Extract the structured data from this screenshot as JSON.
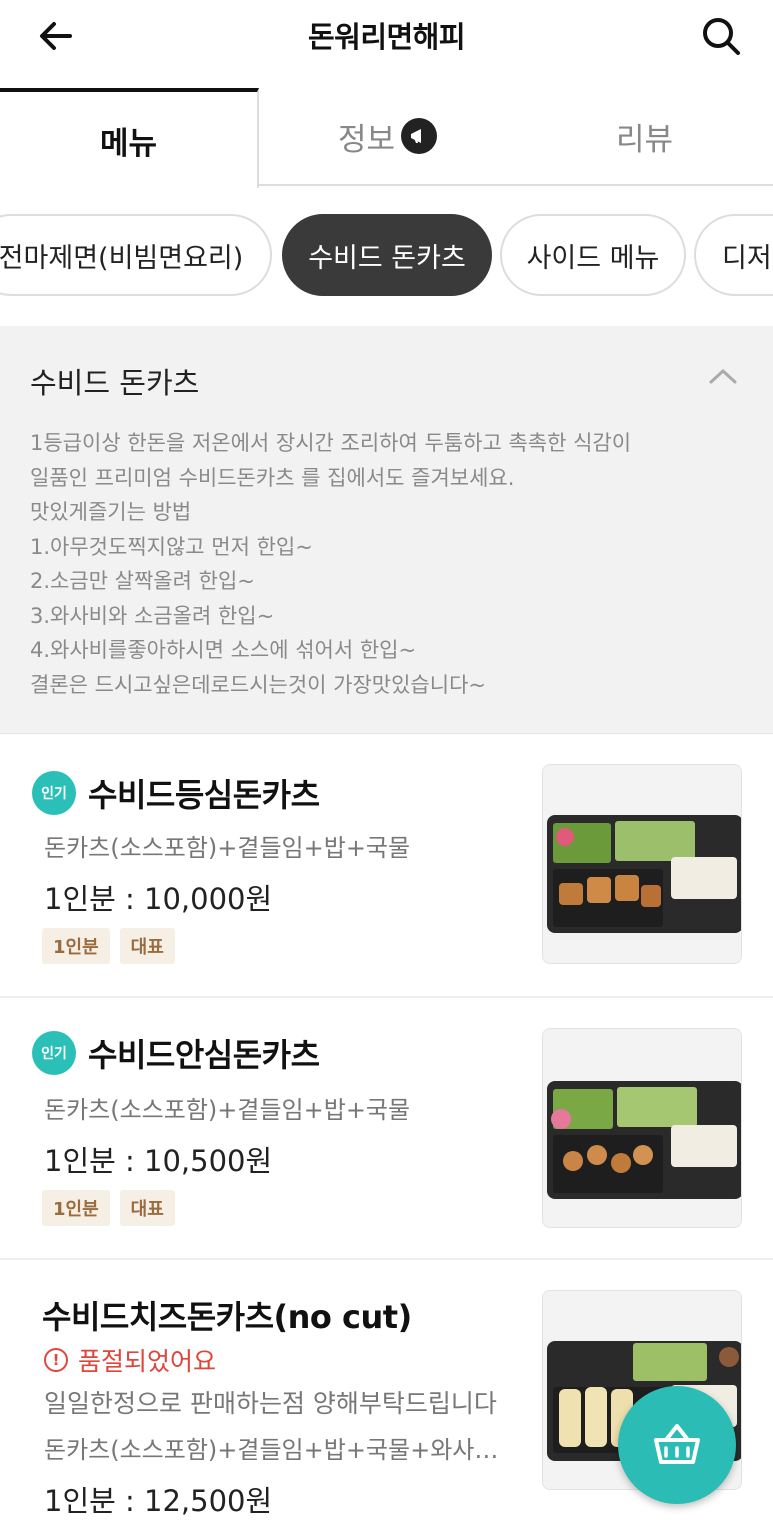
{
  "header": {
    "title": "돈워리면해피",
    "back_icon": "arrow-left-icon",
    "search_icon": "search-icon"
  },
  "tabs": [
    {
      "label": "메뉴",
      "active": true
    },
    {
      "label": "정보",
      "active": false,
      "icon": "megaphone-icon"
    },
    {
      "label": "리뷰",
      "active": false
    }
  ],
  "categories": [
    {
      "label": "전마제면(비빔면요리)",
      "active": false
    },
    {
      "label": "수비드 돈카츠",
      "active": true
    },
    {
      "label": "사이드 메뉴",
      "active": false
    },
    {
      "label": "디저트",
      "active": false
    }
  ],
  "section": {
    "title": "수비드 돈카츠",
    "description": [
      "1등급이상 한돈을 저온에서 장시간 조리하여 두툼하고 촉촉한 식감이",
      "일품인 프리미엄 수비드돈카츠 를 집에서도 즐겨보세요.",
      "맛있게즐기는 방법",
      "1.아무것도찍지않고 먼저 한입~",
      "2.소금만 살짝올려 한입~",
      "3.와사비와 소금올려 한입~",
      "4.와사비를좋아하시면 소스에 섞어서 한입~",
      "결론은 드시고싶은데로드시는것이 가장맛있습니다~"
    ]
  },
  "items": [
    {
      "popular_label": "인기",
      "name": "수비드등심돈카츠",
      "description": "돈카츠(소스포함)+곁들임+밥+국물",
      "price": "1인분 : 10,000원",
      "tags": [
        "1인분",
        "대표"
      ]
    },
    {
      "popular_label": "인기",
      "name": "수비드안심돈카츠",
      "description": "돈카츠(소스포함)+곁들임+밥+국물",
      "price": "1인분 : 10,500원",
      "tags": [
        "1인분",
        "대표"
      ]
    },
    {
      "name": "수비드치즈돈카츠(no cut)",
      "soldout": "품절되었어요",
      "note": "일일한정으로 판매하는점 양해부탁드립니다",
      "description": "돈카츠(소스포함)+곁들임+밥+국물+와사…",
      "price": "1인분 : 12,500원"
    }
  ],
  "cart_icon": "basket-icon",
  "colors": {
    "accent": "#2bbcb5",
    "soldout": "#e0453a",
    "tag_bg": "#f6efe6",
    "tag_text": "#9b6b3e"
  }
}
